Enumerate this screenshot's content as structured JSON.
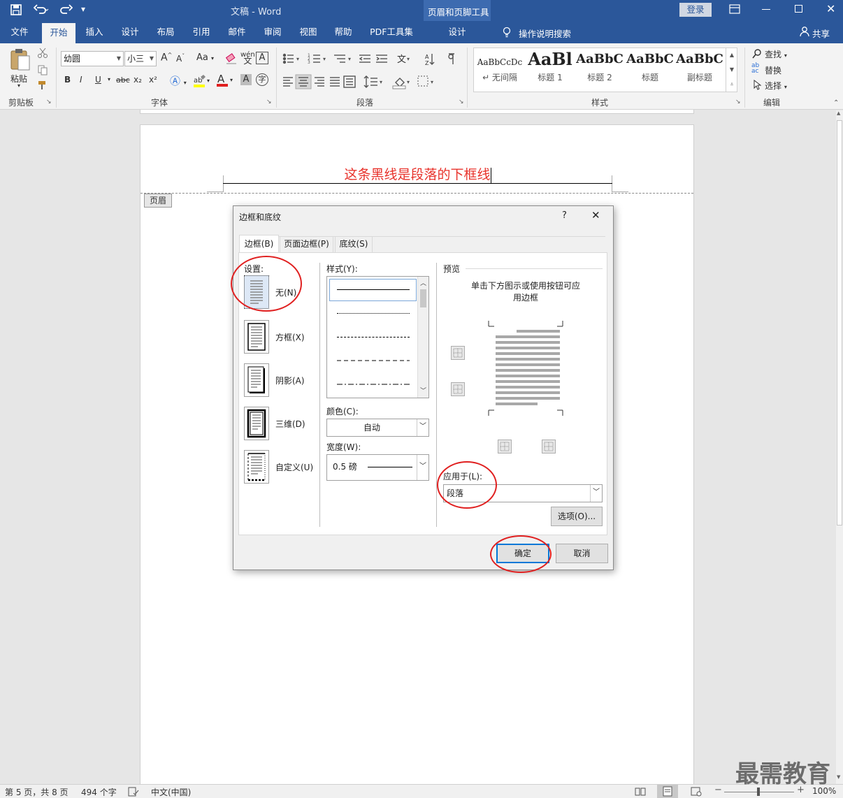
{
  "app": {
    "doc_title": "文稿",
    "app_name": "Word",
    "title_sep": " - ",
    "context_group": "页眉和页脚工具",
    "login": "登录"
  },
  "tabs": [
    "文件",
    "开始",
    "插入",
    "设计",
    "布局",
    "引用",
    "邮件",
    "审阅",
    "视图",
    "帮助",
    "PDF工具集",
    "设计"
  ],
  "tell_me": "操作说明搜索",
  "share": "共享",
  "ribbon": {
    "clipboard": {
      "paste": "粘贴",
      "label": "剪贴板"
    },
    "font": {
      "name": "幼圆",
      "size": "小三",
      "label": "字体",
      "grow": "A",
      "shrink": "A",
      "case": "Aa",
      "bold": "B",
      "italic": "I",
      "underline": "U",
      "strike": "abc",
      "sub": "x₂",
      "sup": "x²",
      "pinyin": "wén",
      "char_border": "A",
      "color_a": "A",
      "shade_a": "A",
      "enclose": "字"
    },
    "paragraph": {
      "label": "段落"
    },
    "styles": {
      "label": "样式",
      "items": [
        {
          "preview": "AaBbCcDc",
          "name": "↵ 无间隔"
        },
        {
          "preview": "AaBl",
          "name": "标题 1"
        },
        {
          "preview": "AaBbC",
          "name": "标题 2"
        },
        {
          "preview": "AaBbC",
          "name": "标题"
        },
        {
          "preview": "AaBbC",
          "name": "副标题"
        }
      ]
    },
    "editing": {
      "find": "查找",
      "replace": "替换",
      "select": "选择",
      "label": "编辑"
    }
  },
  "document": {
    "header_text": "这条黑线是段落的下框线",
    "header_tag": "页眉",
    "header_text_color": "#e8322b"
  },
  "dialog": {
    "title": "边框和底纹",
    "help": "?",
    "close": "✕",
    "tabs": [
      "边框(B)",
      "页面边框(P)",
      "底纹(S)"
    ],
    "settings_label": "设置:",
    "settings": [
      "无(N)",
      "方框(X)",
      "阴影(A)",
      "三维(D)",
      "自定义(U)"
    ],
    "style_label": "样式(Y):",
    "color_label": "颜色(C):",
    "color_value": "自动",
    "width_label": "宽度(W):",
    "width_value": "0.5 磅",
    "preview_label": "预览",
    "preview_hint": "单击下方图示或使用按钮可应用边框",
    "apply_label": "应用于(L):",
    "apply_value": "段落",
    "options_button": "选项(O)...",
    "ok_button": "确定",
    "cancel_button": "取消"
  },
  "status": {
    "page": "第 5 页，共 8 页",
    "words": "494 个字",
    "language": "中文(中国)",
    "zoom": "100%"
  },
  "watermark": "最需教育",
  "colors": {
    "word_blue": "#2b579a",
    "annotation_red": "#e02020"
  }
}
